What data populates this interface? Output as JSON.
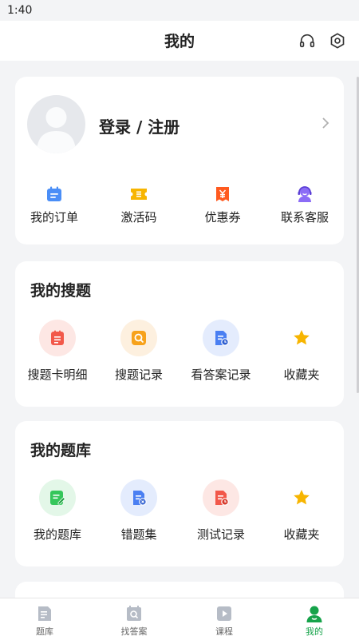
{
  "status": {
    "time": "1:40"
  },
  "header": {
    "title": "我的",
    "icons": [
      "headset-icon",
      "gear-icon"
    ]
  },
  "profile": {
    "login_label": "登录 / 注册"
  },
  "account_row": [
    {
      "label": "我的订单",
      "icon": "calendar-order-icon",
      "color": "#4a8ef7"
    },
    {
      "label": "激活码",
      "icon": "ticket-icon",
      "color": "#f7b500"
    },
    {
      "label": "优惠券",
      "icon": "coupon-yen-icon",
      "color": "#ff5a1f"
    },
    {
      "label": "联系客服",
      "icon": "customer-service-icon",
      "color": "#8b6cf6"
    }
  ],
  "search_section": {
    "title": "我的搜题",
    "items": [
      {
        "label": "搜题卡明细",
        "icon": "card-detail-icon",
        "color": "#f2584a",
        "bg": "#fde7e4"
      },
      {
        "label": "搜题记录",
        "icon": "search-record-icon",
        "color": "#f7a21b",
        "bg": "#fdf0df"
      },
      {
        "label": "看答案记录",
        "icon": "answer-record-icon",
        "color": "#4a7ff2",
        "bg": "#e4ecfd"
      },
      {
        "label": "收藏夹",
        "icon": "star-icon",
        "color": "#f7b500",
        "bg": "#ffffff"
      }
    ]
  },
  "bank_section": {
    "title": "我的题库",
    "items": [
      {
        "label": "我的题库",
        "icon": "question-bank-icon",
        "color": "#35c65a",
        "bg": "#e3f7e8"
      },
      {
        "label": "错题集",
        "icon": "wrong-questions-icon",
        "color": "#4a7ff2",
        "bg": "#e4ecfd"
      },
      {
        "label": "测试记录",
        "icon": "test-record-icon",
        "color": "#f2584a",
        "bg": "#fde7e4"
      },
      {
        "label": "收藏夹",
        "icon": "star-icon",
        "color": "#f7b500",
        "bg": "#ffffff"
      }
    ]
  },
  "tabbar": [
    {
      "label": "题库",
      "icon": "book-icon",
      "active": false
    },
    {
      "label": "找答案",
      "icon": "find-answer-icon",
      "active": false
    },
    {
      "label": "课程",
      "icon": "play-icon",
      "active": false
    },
    {
      "label": "我的",
      "icon": "person-icon",
      "active": true
    }
  ],
  "colors": {
    "active_tab": "#16a34a",
    "inactive_icon": "#b6bcc6"
  }
}
